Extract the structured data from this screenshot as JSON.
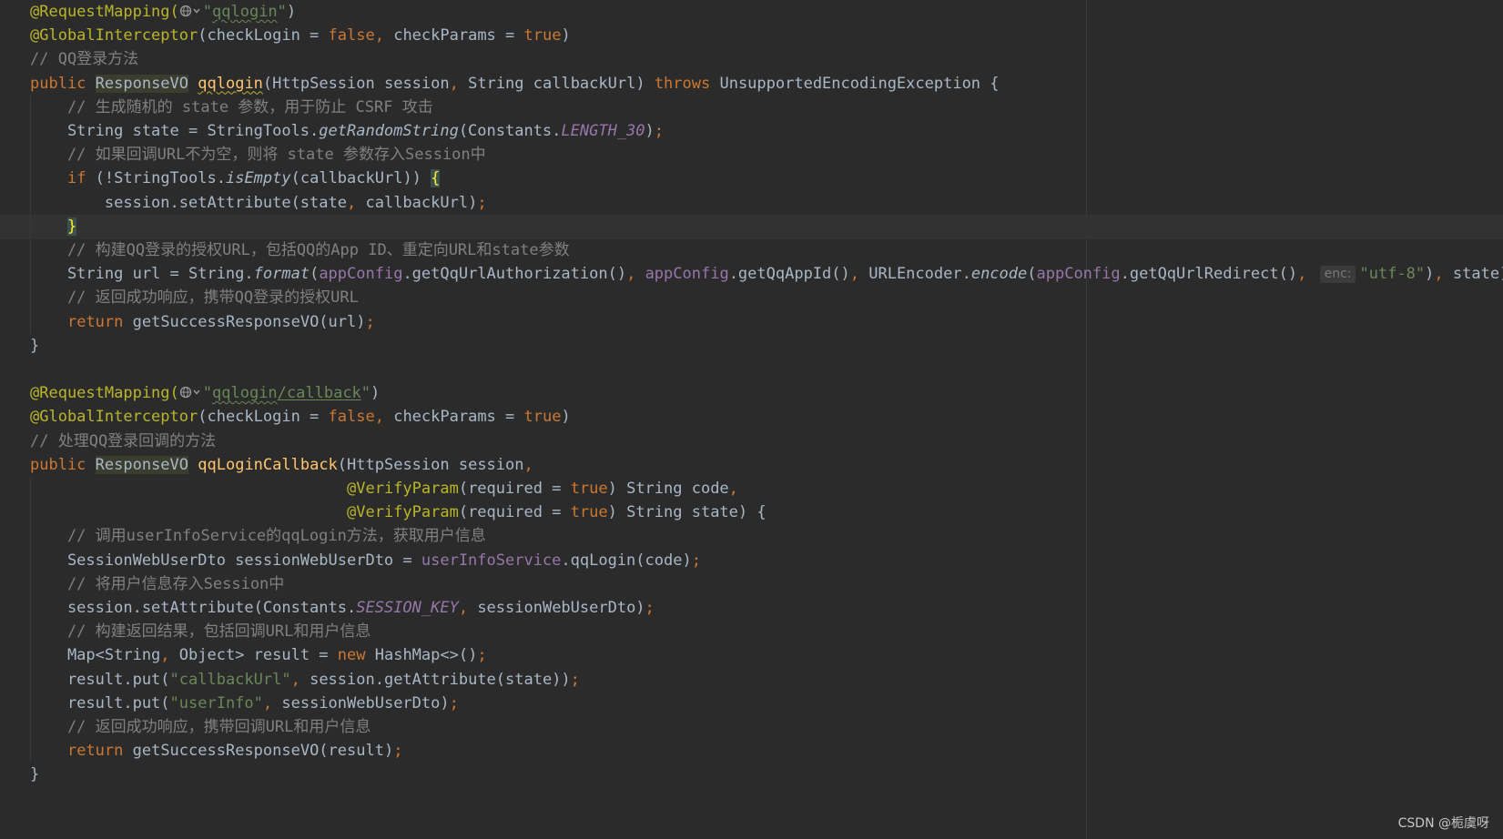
{
  "editor": {
    "watermark": "CSDN @栀虞呀",
    "inlay_hint_enc": "enc:",
    "icons": [
      "globe-icon",
      "chevron-down-icon"
    ],
    "lines": [
      [
        {
          "t": "@RequestMapping(",
          "c": "ann"
        },
        {
          "icon": "globe"
        },
        {
          "t": "\"",
          "c": "str"
        },
        {
          "t": "qqlogin",
          "c": "str squig"
        },
        {
          "t": "\"",
          "c": "str"
        },
        {
          "t": ")",
          "c": ""
        }
      ],
      [
        {
          "t": "@GlobalInterceptor",
          "c": "ann"
        },
        {
          "t": "(checkLogin = ",
          "c": ""
        },
        {
          "t": "false",
          "c": "kw"
        },
        {
          "t": ", ",
          "c": "kw"
        },
        {
          "t": "checkParams = ",
          "c": ""
        },
        {
          "t": "true",
          "c": "kw"
        },
        {
          "t": ")",
          "c": ""
        }
      ],
      [
        {
          "t": "// QQ登录方法",
          "c": "cm"
        }
      ],
      [
        {
          "t": "public ",
          "c": "kw"
        },
        {
          "t": "ResponseVO",
          "c": "hl"
        },
        {
          "t": " ",
          "c": ""
        },
        {
          "t": "qqlogin",
          "c": "fn squig-fn"
        },
        {
          "t": "(HttpSession session",
          "c": ""
        },
        {
          "t": ", ",
          "c": "kw"
        },
        {
          "t": "String callbackUrl) ",
          "c": ""
        },
        {
          "t": "throws ",
          "c": "kw"
        },
        {
          "t": "UnsupportedEncodingException {",
          "c": ""
        }
      ],
      [
        {
          "t": "    // 生成随机的 state 参数，用于防止 CSRF 攻击",
          "c": "cm"
        }
      ],
      [
        {
          "t": "    String state = StringTools.",
          "c": ""
        },
        {
          "t": "getRandomString",
          "c": "ital"
        },
        {
          "t": "(Constants.",
          "c": ""
        },
        {
          "t": "LENGTH_30",
          "c": "cst"
        },
        {
          "t": ")",
          "c": ""
        },
        {
          "t": ";",
          "c": "kw"
        }
      ],
      [
        {
          "t": "    // 如果回调URL不为空，则将 state 参数存入Session中",
          "c": "cm"
        }
      ],
      [
        {
          "t": "    ",
          "c": ""
        },
        {
          "t": "if ",
          "c": "kw"
        },
        {
          "t": "(!StringTools.",
          "c": ""
        },
        {
          "t": "isEmpty",
          "c": "ital"
        },
        {
          "t": "(callbackUrl)) ",
          "c": ""
        },
        {
          "t": "{",
          "c": "match"
        }
      ],
      [
        {
          "t": "        session.setAttribute(state",
          "c": ""
        },
        {
          "t": ", ",
          "c": "kw"
        },
        {
          "t": "callbackUrl)",
          "c": ""
        },
        {
          "t": ";",
          "c": "kw"
        }
      ],
      [
        {
          "t": "    ",
          "c": ""
        },
        {
          "t": "}",
          "c": "match"
        }
      ],
      [
        {
          "t": "    // 构建QQ登录的授权URL，包括QQ的App ID、重定向URL和state参数",
          "c": "cm"
        }
      ],
      [
        {
          "t": "    String url = String.",
          "c": ""
        },
        {
          "t": "format",
          "c": "ital"
        },
        {
          "t": "(",
          "c": ""
        },
        {
          "t": "appConfig",
          "c": "fld"
        },
        {
          "t": ".getQqUrlAuthorization()",
          "c": ""
        },
        {
          "t": ", ",
          "c": "kw"
        },
        {
          "t": "appConfig",
          "c": "fld"
        },
        {
          "t": ".getQqAppId()",
          "c": ""
        },
        {
          "t": ", ",
          "c": "kw"
        },
        {
          "t": "URLEncoder.",
          "c": ""
        },
        {
          "t": "encode",
          "c": "ital"
        },
        {
          "t": "(",
          "c": ""
        },
        {
          "t": "appConfig",
          "c": "fld"
        },
        {
          "t": ".getQqUrlRedirect()",
          "c": ""
        },
        {
          "t": ", ",
          "c": "kw"
        },
        {
          "hint": "enc:"
        },
        {
          "t": "\"utf-8\"",
          "c": "str"
        },
        {
          "t": ")",
          "c": ""
        },
        {
          "t": ", ",
          "c": "kw"
        },
        {
          "t": "state)",
          "c": ""
        },
        {
          "t": ";",
          "c": "kw"
        }
      ],
      [
        {
          "t": "    // 返回成功响应，携带QQ登录的授权URL",
          "c": "cm"
        }
      ],
      [
        {
          "t": "    ",
          "c": ""
        },
        {
          "t": "return ",
          "c": "kw"
        },
        {
          "t": "getSuccessResponseVO(url)",
          "c": ""
        },
        {
          "t": ";",
          "c": "kw"
        }
      ],
      [
        {
          "t": "}",
          "c": ""
        }
      ],
      [],
      [
        {
          "t": "@RequestMapping(",
          "c": "ann"
        },
        {
          "icon": "globe"
        },
        {
          "t": "\"",
          "c": "str"
        },
        {
          "t": "qqlogin",
          "c": "str squig"
        },
        {
          "t": "/callback",
          "c": "str u"
        },
        {
          "t": "\"",
          "c": "str"
        },
        {
          "t": ")",
          "c": ""
        }
      ],
      [
        {
          "t": "@GlobalInterceptor",
          "c": "ann"
        },
        {
          "t": "(checkLogin = ",
          "c": ""
        },
        {
          "t": "false",
          "c": "kw"
        },
        {
          "t": ", ",
          "c": "kw"
        },
        {
          "t": "checkParams = ",
          "c": ""
        },
        {
          "t": "true",
          "c": "kw"
        },
        {
          "t": ")",
          "c": ""
        }
      ],
      [
        {
          "t": "// 处理QQ登录回调的方法",
          "c": "cm"
        }
      ],
      [
        {
          "t": "public ",
          "c": "kw"
        },
        {
          "t": "ResponseVO",
          "c": "hl"
        },
        {
          "t": " ",
          "c": ""
        },
        {
          "t": "qqLoginCallback",
          "c": "fn"
        },
        {
          "t": "(HttpSession session",
          "c": ""
        },
        {
          "t": ",",
          "c": "kw"
        }
      ],
      [
        {
          "t": "                                  ",
          "c": ""
        },
        {
          "t": "@VerifyParam",
          "c": "ann"
        },
        {
          "t": "(required = ",
          "c": ""
        },
        {
          "t": "true",
          "c": "kw"
        },
        {
          "t": ") String code",
          "c": ""
        },
        {
          "t": ",",
          "c": "kw"
        }
      ],
      [
        {
          "t": "                                  ",
          "c": ""
        },
        {
          "t": "@VerifyParam",
          "c": "ann"
        },
        {
          "t": "(required = ",
          "c": ""
        },
        {
          "t": "true",
          "c": "kw"
        },
        {
          "t": ") String state) {",
          "c": ""
        }
      ],
      [
        {
          "t": "    // 调用userInfoService的qqLogin方法，获取用户信息",
          "c": "cm"
        }
      ],
      [
        {
          "t": "    SessionWebUserDto sessionWebUserDto = ",
          "c": ""
        },
        {
          "t": "userInfoService",
          "c": "fld"
        },
        {
          "t": ".qqLogin(code)",
          "c": ""
        },
        {
          "t": ";",
          "c": "kw"
        }
      ],
      [
        {
          "t": "    // 将用户信息存入Session中",
          "c": "cm"
        }
      ],
      [
        {
          "t": "    session.setAttribute(Constants.",
          "c": ""
        },
        {
          "t": "SESSION_KEY",
          "c": "cst"
        },
        {
          "t": ", ",
          "c": "kw"
        },
        {
          "t": "sessionWebUserDto)",
          "c": ""
        },
        {
          "t": ";",
          "c": "kw"
        }
      ],
      [
        {
          "t": "    // 构建返回结果，包括回调URL和用户信息",
          "c": "cm"
        }
      ],
      [
        {
          "t": "    Map<String",
          "c": ""
        },
        {
          "t": ", ",
          "c": "kw"
        },
        {
          "t": "Object> result = ",
          "c": ""
        },
        {
          "t": "new ",
          "c": "kw"
        },
        {
          "t": "HashMap<>()",
          "c": ""
        },
        {
          "t": ";",
          "c": "kw"
        }
      ],
      [
        {
          "t": "    result.put(",
          "c": ""
        },
        {
          "t": "\"callbackUrl\"",
          "c": "str"
        },
        {
          "t": ", ",
          "c": "kw"
        },
        {
          "t": "session.getAttribute(state))",
          "c": ""
        },
        {
          "t": ";",
          "c": "kw"
        }
      ],
      [
        {
          "t": "    result.put(",
          "c": ""
        },
        {
          "t": "\"userInfo\"",
          "c": "str"
        },
        {
          "t": ", ",
          "c": "kw"
        },
        {
          "t": "sessionWebUserDto)",
          "c": ""
        },
        {
          "t": ";",
          "c": "kw"
        }
      ],
      [
        {
          "t": "    // 返回成功响应，携带回调URL和用户信息",
          "c": "cm"
        }
      ],
      [
        {
          "t": "    ",
          "c": ""
        },
        {
          "t": "return ",
          "c": "kw"
        },
        {
          "t": "getSuccessResponseVO(result)",
          "c": ""
        },
        {
          "t": ";",
          "c": "kw"
        }
      ],
      [
        {
          "t": "}",
          "c": ""
        }
      ]
    ]
  }
}
